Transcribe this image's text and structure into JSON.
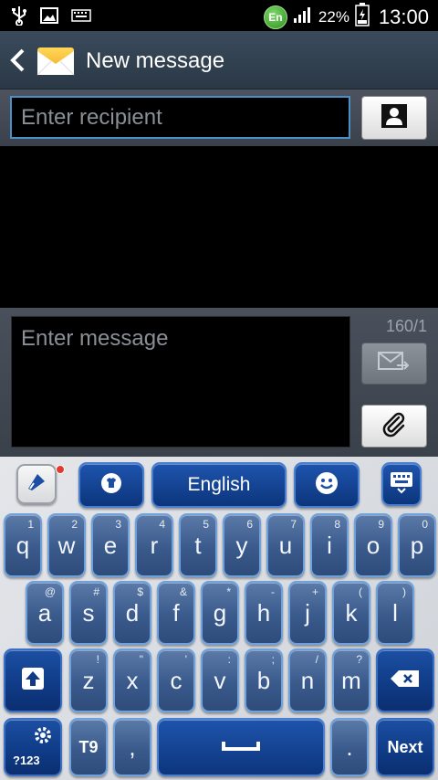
{
  "status_bar": {
    "language_badge": "En",
    "battery_percent": "22%",
    "time": "13:00",
    "icons": [
      "usb-icon",
      "image-icon",
      "keyboard-icon",
      "signal-icon",
      "battery-icon"
    ]
  },
  "action_bar": {
    "title": "New message",
    "icons": [
      "back-icon",
      "envelope-icon"
    ]
  },
  "recipient": {
    "placeholder": "Enter recipient",
    "value": ""
  },
  "compose": {
    "placeholder": "Enter message",
    "value": "",
    "char_count": "160/1"
  },
  "keyboard": {
    "language_label": "English",
    "row1": [
      {
        "main": "q",
        "sub": "1"
      },
      {
        "main": "w",
        "sub": "2"
      },
      {
        "main": "e",
        "sub": "3"
      },
      {
        "main": "r",
        "sub": "4"
      },
      {
        "main": "t",
        "sub": "5"
      },
      {
        "main": "y",
        "sub": "6"
      },
      {
        "main": "u",
        "sub": "7"
      },
      {
        "main": "i",
        "sub": "8"
      },
      {
        "main": "o",
        "sub": "9"
      },
      {
        "main": "p",
        "sub": "0"
      }
    ],
    "row2": [
      {
        "main": "a",
        "sub": "@"
      },
      {
        "main": "s",
        "sub": "#"
      },
      {
        "main": "d",
        "sub": "$"
      },
      {
        "main": "f",
        "sub": "&"
      },
      {
        "main": "g",
        "sub": "*"
      },
      {
        "main": "h",
        "sub": "-"
      },
      {
        "main": "j",
        "sub": "+"
      },
      {
        "main": "k",
        "sub": "("
      },
      {
        "main": "l",
        "sub": ")"
      }
    ],
    "row3": [
      {
        "main": "z",
        "sub": "!"
      },
      {
        "main": "x",
        "sub": "\""
      },
      {
        "main": "c",
        "sub": "'"
      },
      {
        "main": "v",
        "sub": ":"
      },
      {
        "main": "b",
        "sub": ";"
      },
      {
        "main": "n",
        "sub": "/"
      },
      {
        "main": "m",
        "sub": "?"
      }
    ],
    "sym_label": "?123",
    "t9_label": "T9",
    "comma_label": ",",
    "period_label": ".",
    "next_label": "Next"
  },
  "colors": {
    "key_blue": "#3a5a8c",
    "key_border": "#6fa2dc",
    "util_blue": "#0f3a85",
    "accent_focus": "#4a90c8"
  }
}
